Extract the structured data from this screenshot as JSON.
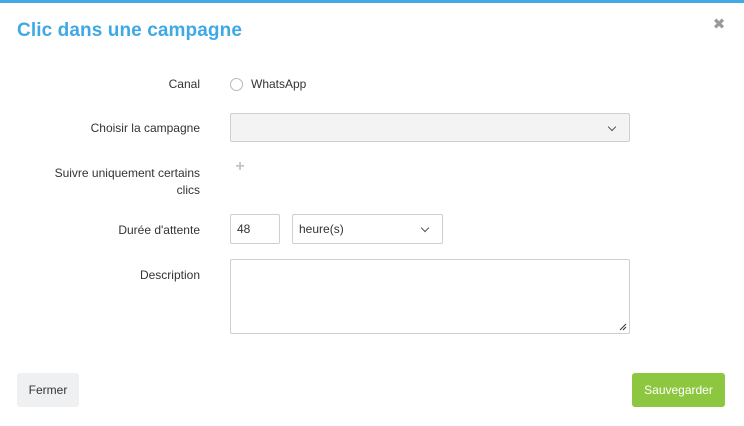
{
  "modal": {
    "title": "Clic dans une campagne",
    "close_icon": "close-icon"
  },
  "form": {
    "canal": {
      "label": "Canal",
      "option": "WhatsApp",
      "selected": false
    },
    "campagne": {
      "label": "Choisir la campagne",
      "value": ""
    },
    "clics": {
      "label_line1": "Suivre uniquement certains",
      "label_line2": "clics",
      "add_icon": "plus-icon"
    },
    "duree": {
      "label": "Durée d'attente",
      "value": "48",
      "unit": "heure(s)"
    },
    "description": {
      "label": "Description",
      "value": ""
    }
  },
  "footer": {
    "close_label": "Fermer",
    "save_label": "Sauvegarder"
  },
  "colors": {
    "accent": "#3fa9e6",
    "save": "#8dc63f",
    "secondary_button": "#eef0f2"
  }
}
